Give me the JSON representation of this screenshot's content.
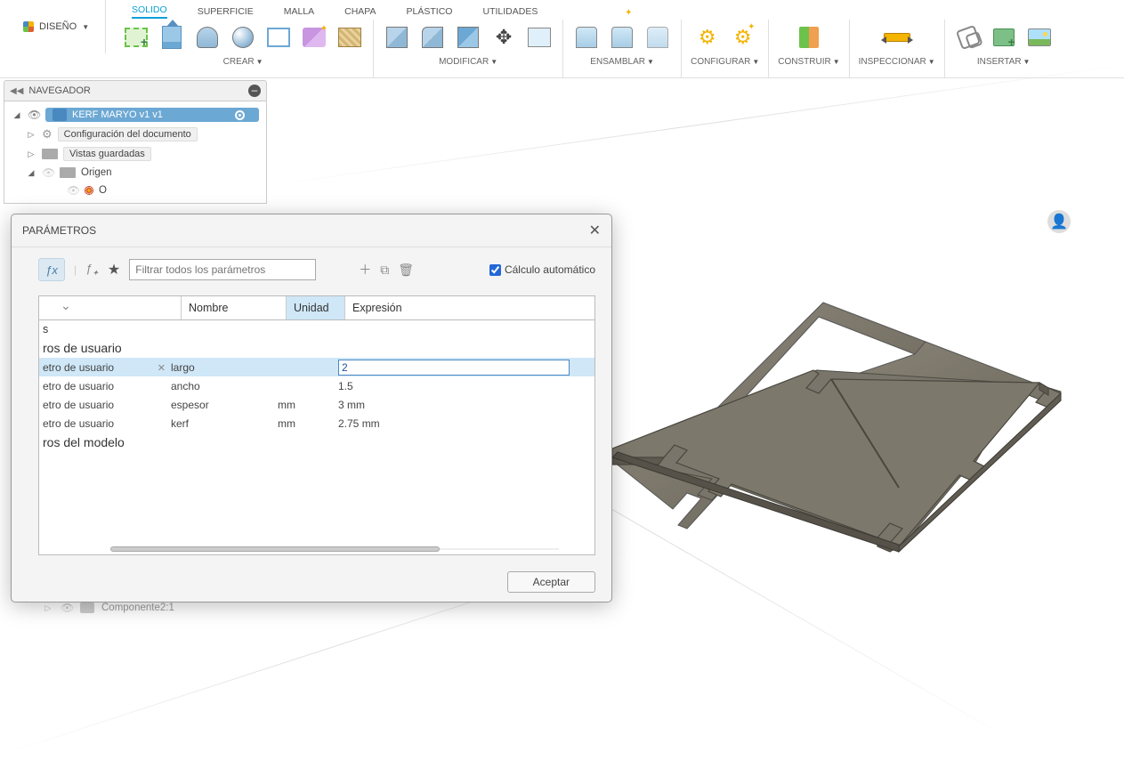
{
  "ribbon": {
    "design_label": "DISEÑO",
    "tabs": [
      "SOLIDO",
      "SUPERFICIE",
      "MALLA",
      "CHAPA",
      "PLÁSTICO",
      "UTILIDADES"
    ],
    "active_tab": 0,
    "groups": {
      "crear": "CREAR",
      "modificar": "MODIFICAR",
      "ensamblar": "ENSAMBLAR",
      "configurar": "CONFIGURAR",
      "construir": "CONSTRUIR",
      "inspeccionar": "INSPECCIONAR",
      "insertar": "INSERTAR"
    }
  },
  "navigator": {
    "title": "NAVEGADOR",
    "root": "KERF MARYO v1 v1",
    "items": {
      "doc_config": "Configuración del documento",
      "saved_views": "Vistas guardadas",
      "origin": "Origen",
      "origin_o": "O",
      "component2": "Componente2:1"
    }
  },
  "dialog": {
    "title": "PARÁMETROS",
    "filter_placeholder": "Filtrar todos los parámetros",
    "auto_calc_label": "Cálculo automático",
    "cols": {
      "name": "Nombre",
      "unit": "Unidad",
      "expr": "Expresión"
    },
    "sections": {
      "favs": "s",
      "user": "ros de usuario",
      "model": "ros del modelo"
    },
    "user_row_prefix": "etro de usuario",
    "rows": [
      {
        "name": "largo",
        "unit": "",
        "expr_edit": "2",
        "selected": true
      },
      {
        "name": "ancho",
        "unit": "",
        "expr": "1.5"
      },
      {
        "name": "espesor",
        "unit": "mm",
        "expr": "3 mm"
      },
      {
        "name": "kerf",
        "unit": "mm",
        "expr": "2.75 mm"
      }
    ],
    "accept": "Aceptar"
  }
}
